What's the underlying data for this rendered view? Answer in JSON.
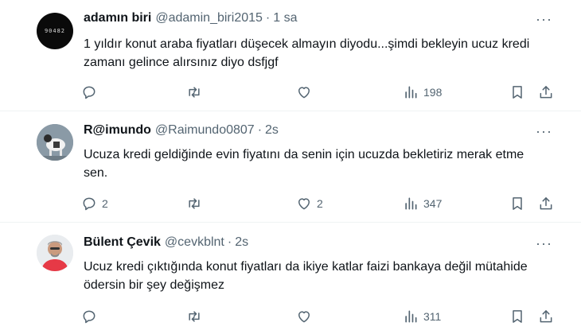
{
  "tweets": [
    {
      "avatar_text": "90482",
      "name": "adamın biri",
      "handle": "@adamin_biri2015",
      "dot": "·",
      "time": "1 sa",
      "more": "···",
      "text": "1 yıldır konut araba fiyatları düşecek almayın diyodu...şimdi bekleyin ucuz kredi zamanı gelince alırsınız diyo dsfjgf",
      "replies": "",
      "reposts": "",
      "likes": "",
      "views": "198"
    },
    {
      "name": "R@imundo",
      "handle": "@Raimundo0807",
      "dot": "·",
      "time": "2s",
      "more": "···",
      "text": "Ucuza kredi geldiğinde evin fiyatını da senin için ucuzda bekletiriz merak etme sen.",
      "replies": "2",
      "reposts": "",
      "likes": "2",
      "views": "347"
    },
    {
      "name": "Bülent Çevik",
      "handle": "@cevkblnt",
      "dot": "·",
      "time": "2s",
      "more": "···",
      "text": "Ucuz kredi çıktığında konut fiyatları da ikiye katlar faizi bankaya değil mütahide ödersin bir şey değişmez",
      "replies": "",
      "reposts": "",
      "likes": "",
      "views": "311"
    }
  ],
  "icons": {
    "reply": "reply-icon",
    "repost": "repost-icon",
    "like": "heart-icon",
    "views": "views-icon",
    "bookmark": "bookmark-icon",
    "share": "share-icon"
  },
  "colors": {
    "text": "#0f1419",
    "secondary": "#536471",
    "divider": "#eff3f4"
  }
}
